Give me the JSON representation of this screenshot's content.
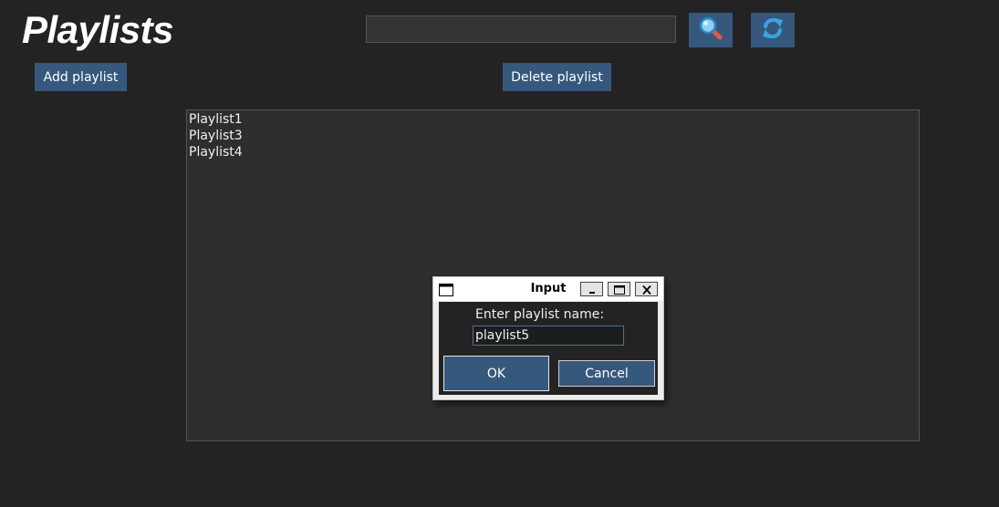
{
  "header": {
    "title": "Playlists",
    "search": {
      "value": "",
      "placeholder": ""
    },
    "search_icon": "magnifier-icon",
    "refresh_icon": "refresh-icon"
  },
  "actions": {
    "add_label": "Add playlist",
    "delete_label": "Delete playlist"
  },
  "playlists": {
    "items": [
      "Playlist1",
      "Playlist3",
      "Playlist4"
    ]
  },
  "dialog": {
    "title": "Input",
    "prompt": "Enter playlist name:",
    "input_value": "playlist5",
    "ok_label": "OK",
    "cancel_label": "Cancel",
    "controls": [
      "minimize-icon",
      "maximize-icon",
      "close-icon"
    ]
  },
  "colors": {
    "background": "#232323",
    "accent": "#36587c",
    "list_background": "#2e2e2e",
    "refresh_arrows": "#3aa3e6"
  }
}
